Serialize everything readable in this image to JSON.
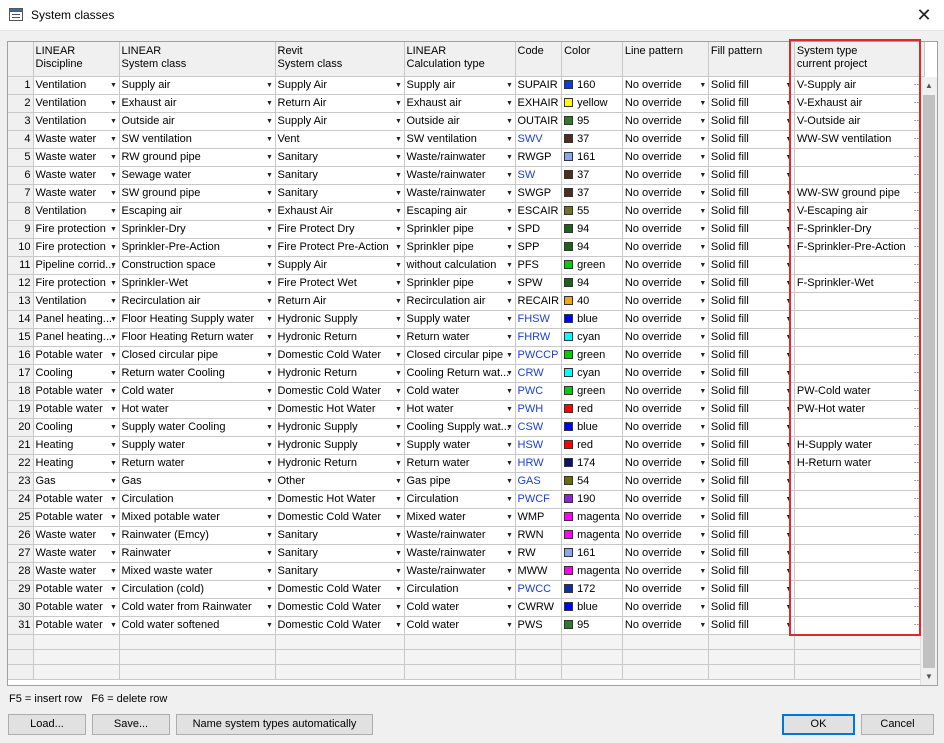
{
  "window": {
    "title": "System classes",
    "close_label": "✕"
  },
  "columns": [
    {
      "line1": "",
      "line2": ""
    },
    {
      "line1": "LINEAR",
      "line2": "Discipline"
    },
    {
      "line1": "LINEAR",
      "line2": "System class"
    },
    {
      "line1": "Revit",
      "line2": "System class"
    },
    {
      "line1": "LINEAR",
      "line2": "Calculation type"
    },
    {
      "line1": "Code",
      "line2": ""
    },
    {
      "line1": "Color",
      "line2": ""
    },
    {
      "line1": "Line pattern",
      "line2": ""
    },
    {
      "line1": "Fill pattern",
      "line2": ""
    },
    {
      "line1": "System type",
      "line2": "current project"
    }
  ],
  "rows": [
    {
      "num": "1",
      "discipline": "Ventilation",
      "linear_class": "Supply air",
      "revit_class": "Supply Air",
      "calc": "Supply air",
      "code": "SUPAIR",
      "code_link": false,
      "color_name": "160",
      "color_hex": "#0a3cd8",
      "line": "No override",
      "fill": "Solid fill",
      "systype": "V-Supply air"
    },
    {
      "num": "2",
      "discipline": "Ventilation",
      "linear_class": "Exhaust air",
      "revit_class": "Return Air",
      "calc": "Exhaust air",
      "code": "EXHAIR",
      "code_link": false,
      "color_name": "yellow",
      "color_hex": "#ffff00",
      "line": "No override",
      "fill": "Solid fill",
      "systype": "V-Exhaust air"
    },
    {
      "num": "3",
      "discipline": "Ventilation",
      "linear_class": "Outside air",
      "revit_class": "Supply Air",
      "calc": "Outside air",
      "code": "OUTAIR",
      "code_link": false,
      "color_name": "95",
      "color_hex": "#2f7a2f",
      "line": "No override",
      "fill": "Solid fill",
      "systype": "V-Outside air"
    },
    {
      "num": "4",
      "discipline": "Waste water",
      "linear_class": "SW ventilation",
      "revit_class": "Vent",
      "calc": "SW ventilation",
      "code": "SWV",
      "code_link": true,
      "color_name": "37",
      "color_hex": "#4b3020",
      "line": "No override",
      "fill": "Solid fill",
      "systype": "WW-SW ventilation"
    },
    {
      "num": "5",
      "discipline": "Waste water",
      "linear_class": "RW ground pipe",
      "revit_class": "Sanitary",
      "calc": "Waste/rainwater",
      "code": "RWGP",
      "code_link": false,
      "color_name": "161",
      "color_hex": "#8aa8e8",
      "line": "No override",
      "fill": "Solid fill",
      "systype": ""
    },
    {
      "num": "6",
      "discipline": "Waste water",
      "linear_class": "Sewage water",
      "revit_class": "Sanitary",
      "calc": "Waste/rainwater",
      "code": "SW",
      "code_link": true,
      "color_name": "37",
      "color_hex": "#4b3020",
      "line": "No override",
      "fill": "Solid fill",
      "systype": ""
    },
    {
      "num": "7",
      "discipline": "Waste water",
      "linear_class": "SW ground pipe",
      "revit_class": "Sanitary",
      "calc": "Waste/rainwater",
      "code": "SWGP",
      "code_link": false,
      "color_name": "37",
      "color_hex": "#4b3020",
      "line": "No override",
      "fill": "Solid fill",
      "systype": "WW-SW ground pipe"
    },
    {
      "num": "8",
      "discipline": "Ventilation",
      "linear_class": "Escaping air",
      "revit_class": "Exhaust Air",
      "calc": "Escaping air",
      "code": "ESCAIR",
      "code_link": false,
      "color_name": "55",
      "color_hex": "#707030",
      "line": "No override",
      "fill": "Solid fill",
      "systype": "V-Escaping air"
    },
    {
      "num": "9",
      "discipline": "Fire protection",
      "linear_class": "Sprinkler-Dry",
      "revit_class": "Fire Protect Dry",
      "calc": "Sprinkler pipe",
      "code": "SPD",
      "code_link": false,
      "color_name": "94",
      "color_hex": "#1f5f1f",
      "line": "No override",
      "fill": "Solid fill",
      "systype": "F-Sprinkler-Dry"
    },
    {
      "num": "10",
      "discipline": "Fire protection",
      "linear_class": "Sprinkler-Pre-Action",
      "revit_class": "Fire Protect Pre-Action",
      "calc": "Sprinkler pipe",
      "code": "SPP",
      "code_link": false,
      "color_name": "94",
      "color_hex": "#1f5f1f",
      "line": "No override",
      "fill": "Solid fill",
      "systype": "F-Sprinkler-Pre-Action"
    },
    {
      "num": "11",
      "discipline": "Pipeline corrid...",
      "linear_class": "Construction space",
      "revit_class": "Supply Air",
      "calc": "without calculation",
      "code": "PFS",
      "code_link": false,
      "color_name": "green",
      "color_hex": "#00d000",
      "line": "No override",
      "fill": "Solid fill",
      "systype": ""
    },
    {
      "num": "12",
      "discipline": "Fire protection",
      "linear_class": "Sprinkler-Wet",
      "revit_class": "Fire Protect Wet",
      "calc": "Sprinkler pipe",
      "code": "SPW",
      "code_link": false,
      "color_name": "94",
      "color_hex": "#1f5f1f",
      "line": "No override",
      "fill": "Solid fill",
      "systype": "F-Sprinkler-Wet"
    },
    {
      "num": "13",
      "discipline": "Ventilation",
      "linear_class": "Recirculation air",
      "revit_class": "Return Air",
      "calc": "Recirculation air",
      "code": "RECAIR",
      "code_link": false,
      "color_name": "40",
      "color_hex": "#f0a818",
      "line": "No override",
      "fill": "Solid fill",
      "systype": ""
    },
    {
      "num": "14",
      "discipline": "Panel heating...",
      "linear_class": "Floor Heating Supply water",
      "revit_class": "Hydronic Supply",
      "calc": "Supply water",
      "code": "FHSW",
      "code_link": true,
      "color_name": "blue",
      "color_hex": "#0000ff",
      "line": "No override",
      "fill": "Solid fill",
      "systype": ""
    },
    {
      "num": "15",
      "discipline": "Panel heating...",
      "linear_class": "Floor Heating Return water",
      "revit_class": "Hydronic Return",
      "calc": "Return water",
      "code": "FHRW",
      "code_link": true,
      "color_name": "cyan",
      "color_hex": "#00ffff",
      "line": "No override",
      "fill": "Solid fill",
      "systype": ""
    },
    {
      "num": "16",
      "discipline": "Potable water",
      "linear_class": "Closed circular pipe",
      "revit_class": "Domestic Cold Water",
      "calc": "Closed circular pipe",
      "code": "PWCCP",
      "code_link": true,
      "color_name": "green",
      "color_hex": "#00d000",
      "line": "No override",
      "fill": "Solid fill",
      "systype": ""
    },
    {
      "num": "17",
      "discipline": "Cooling",
      "linear_class": "Return water Cooling",
      "revit_class": "Hydronic Return",
      "calc": "Cooling Return wat...",
      "code": "CRW",
      "code_link": true,
      "color_name": "cyan",
      "color_hex": "#00ffff",
      "line": "No override",
      "fill": "Solid fill",
      "systype": ""
    },
    {
      "num": "18",
      "discipline": "Potable water",
      "linear_class": "Cold water",
      "revit_class": "Domestic Cold Water",
      "calc": "Cold water",
      "code": "PWC",
      "code_link": true,
      "color_name": "green",
      "color_hex": "#00d000",
      "line": "No override",
      "fill": "Solid fill",
      "systype": "PW-Cold water"
    },
    {
      "num": "19",
      "discipline": "Potable water",
      "linear_class": "Hot water",
      "revit_class": "Domestic Hot Water",
      "calc": "Hot water",
      "code": "PWH",
      "code_link": true,
      "color_name": "red",
      "color_hex": "#ff0000",
      "line": "No override",
      "fill": "Solid fill",
      "systype": "PW-Hot water"
    },
    {
      "num": "20",
      "discipline": "Cooling",
      "linear_class": "Supply water Cooling",
      "revit_class": "Hydronic Supply",
      "calc": "Cooling Supply wat...",
      "code": "CSW",
      "code_link": true,
      "color_name": "blue",
      "color_hex": "#0000ff",
      "line": "No override",
      "fill": "Solid fill",
      "systype": ""
    },
    {
      "num": "21",
      "discipline": "Heating",
      "linear_class": "Supply water",
      "revit_class": "Hydronic Supply",
      "calc": "Supply water",
      "code": "HSW",
      "code_link": true,
      "color_name": "red",
      "color_hex": "#ff0000",
      "line": "No override",
      "fill": "Solid fill",
      "systype": "H-Supply water"
    },
    {
      "num": "22",
      "discipline": "Heating",
      "linear_class": "Return water",
      "revit_class": "Hydronic Return",
      "calc": "Return water",
      "code": "HRW",
      "code_link": true,
      "color_name": "174",
      "color_hex": "#0a1466",
      "line": "No override",
      "fill": "Solid fill",
      "systype": "H-Return water"
    },
    {
      "num": "23",
      "discipline": "Gas",
      "linear_class": "Gas",
      "revit_class": "Other",
      "calc": "Gas pipe",
      "code": "GAS",
      "code_link": true,
      "color_name": "54",
      "color_hex": "#6a6a10",
      "line": "No override",
      "fill": "Solid fill",
      "systype": ""
    },
    {
      "num": "24",
      "discipline": "Potable water",
      "linear_class": "Circulation",
      "revit_class": "Domestic Hot Water",
      "calc": "Circulation",
      "code": "PWCF",
      "code_link": true,
      "color_name": "190",
      "color_hex": "#8a28c8",
      "line": "No override",
      "fill": "Solid fill",
      "systype": ""
    },
    {
      "num": "25",
      "discipline": "Potable water",
      "linear_class": "Mixed potable water",
      "revit_class": "Domestic Cold Water",
      "calc": "Mixed water",
      "code": "WMP",
      "code_link": false,
      "color_name": "magenta",
      "color_hex": "#ff00ff",
      "line": "No override",
      "fill": "Solid fill",
      "systype": ""
    },
    {
      "num": "26",
      "discipline": "Waste water",
      "linear_class": "Rainwater (Emcy)",
      "revit_class": "Sanitary",
      "calc": "Waste/rainwater",
      "code": "RWN",
      "code_link": false,
      "color_name": "magenta",
      "color_hex": "#ff00ff",
      "line": "No override",
      "fill": "Solid fill",
      "systype": ""
    },
    {
      "num": "27",
      "discipline": "Waste water",
      "linear_class": "Rainwater",
      "revit_class": "Sanitary",
      "calc": "Waste/rainwater",
      "code": "RW",
      "code_link": false,
      "color_name": "161",
      "color_hex": "#8aa8e8",
      "line": "No override",
      "fill": "Solid fill",
      "systype": ""
    },
    {
      "num": "28",
      "discipline": "Waste water",
      "linear_class": "Mixed waste water",
      "revit_class": "Sanitary",
      "calc": "Waste/rainwater",
      "code": "MWW",
      "code_link": false,
      "color_name": "magenta",
      "color_hex": "#ff00ff",
      "line": "No override",
      "fill": "Solid fill",
      "systype": ""
    },
    {
      "num": "29",
      "discipline": "Potable water",
      "linear_class": "Circulation (cold)",
      "revit_class": "Domestic Cold Water",
      "calc": "Circulation",
      "code": "PWCC",
      "code_link": true,
      "color_name": "172",
      "color_hex": "#1030a0",
      "line": "No override",
      "fill": "Solid fill",
      "systype": ""
    },
    {
      "num": "30",
      "discipline": "Potable water",
      "linear_class": "Cold water from Rainwater",
      "revit_class": "Domestic Cold Water",
      "calc": "Cold water",
      "code": "CWRW",
      "code_link": false,
      "color_name": "blue",
      "color_hex": "#0000ff",
      "line": "No override",
      "fill": "Solid fill",
      "systype": ""
    },
    {
      "num": "31",
      "discipline": "Potable water",
      "linear_class": "Cold water softened",
      "revit_class": "Domestic Cold Water",
      "calc": "Cold water",
      "code": "PWS",
      "code_link": false,
      "color_name": "95",
      "color_hex": "#2f7a2f",
      "line": "No override",
      "fill": "Solid fill",
      "systype": ""
    }
  ],
  "footer": {
    "hint": "F5 = insert row   F6 = delete row",
    "load_label": "Load...",
    "save_label": "Save...",
    "auto_name_label": "Name system types automatically",
    "ok_label": "OK",
    "cancel_label": "Cancel"
  },
  "colors": {
    "highlight": "#e0272c",
    "link": "#1c3fd0"
  }
}
